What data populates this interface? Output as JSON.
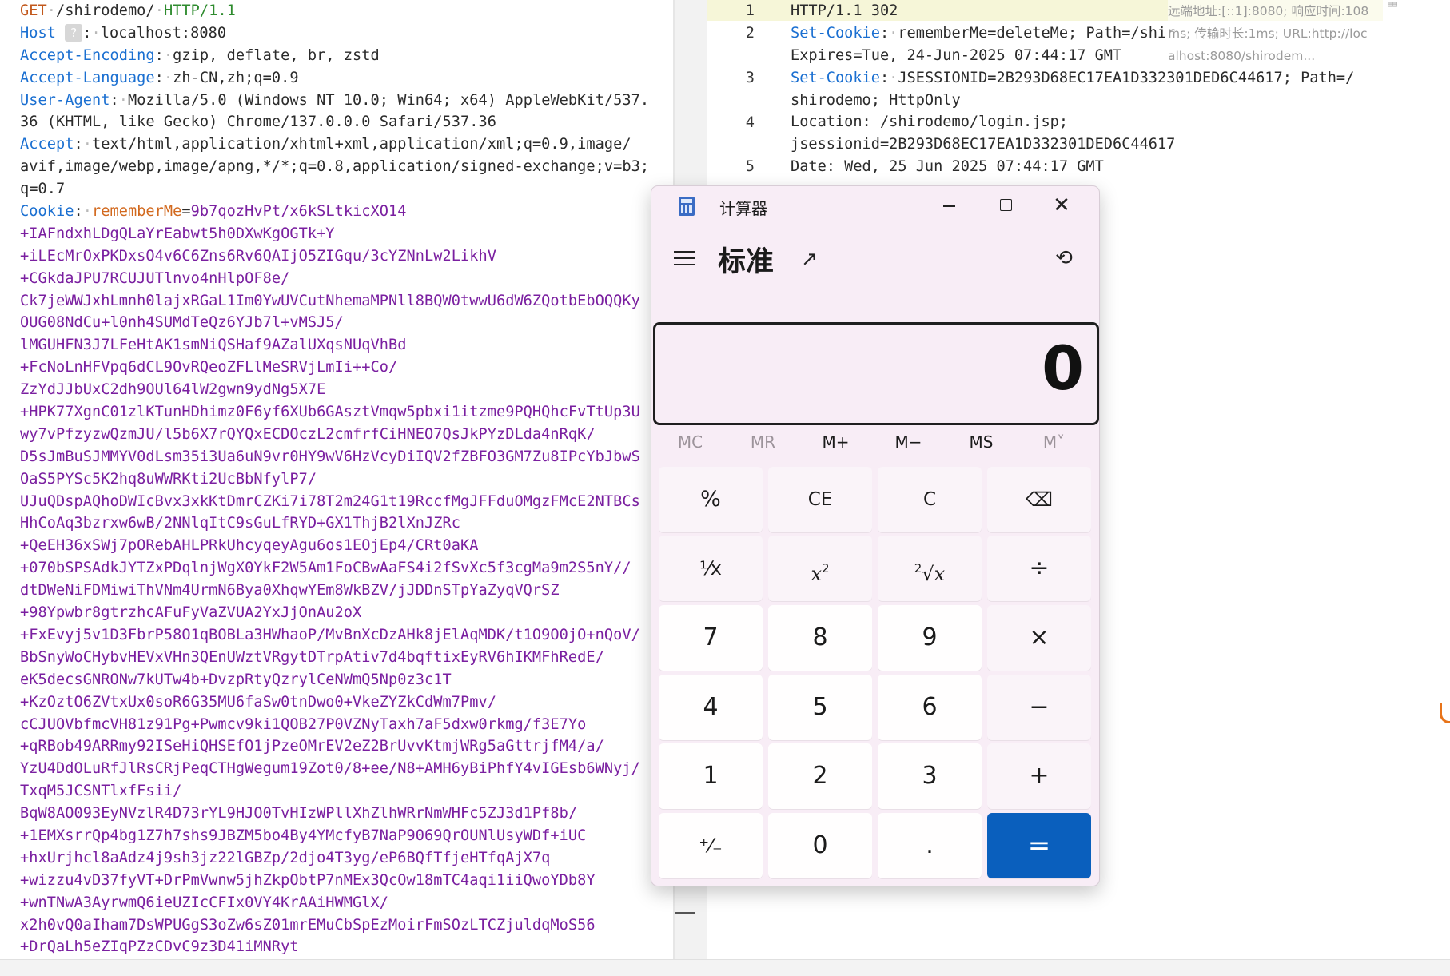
{
  "request": {
    "line1": {
      "method": "GET",
      "path": "/shirodemo/",
      "protocol": "HTTP/1.1"
    },
    "host": {
      "name": "Host",
      "hint": "?",
      "value": "localhost:8080"
    },
    "accept_encoding": {
      "name": "Accept-Encoding",
      "value": "gzip, deflate, br, zstd"
    },
    "accept_language": {
      "name": "Accept-Language",
      "value": "zh-CN,zh;q=0.9"
    },
    "user_agent": {
      "name": "User-Agent",
      "value_1": "Mozilla/5.0 (Windows NT 10.0; Win64; x64) AppleWebKit/537.",
      "value_2": "36 (KHTML, like Gecko) Chrome/137.0.0.0 Safari/537.36"
    },
    "accept": {
      "name": "Accept",
      "value_1": "text/html,application/xhtml+xml,application/xml;q=0.9,image/",
      "value_2": "avif,image/webp,image/apng,*/*;q=0.8,application/signed-exchange;v=b3;",
      "value_3": "q=0.7"
    },
    "cookie": {
      "name": "Cookie",
      "key": "rememberMe",
      "first": "9b7qozHvPt/x6kSLtkicXO14",
      "lines": [
        "+IAFndxhLDgQLaYrEabwt5h0DXwKgOGTk+Y",
        "+iLEcMrOxPKDxsO4v6C6Zns6Rv6QAIjO5ZIGqu/3cYZNnLw2LikhV",
        "+CGkdaJPU7RCUJUTlnvo4nHlpOF8e/",
        "Ck7jeWWJxhLmnh0lajxRGaL1Im0YwUVCutNhemaMPNll8BQW0twwU6dW6ZQotbEbOQQKy",
        "OUG08NdCu+l0nh4SUMdTeQz6YJb7l+vMSJ5/",
        "lMGUHFN3J7LFeHtAK1smNiQSHaf9AZalUXqsNUqVhBd",
        "+FcNoLnHFVpq6dCL9OvRQeoZFLlMeSRVjLmIi++Co/",
        "ZzYdJJbUxC2dh9OUl64lW2gwn9ydNg5X7E",
        "+HPK77XgnC01zlKTunHDhimz0F6yf6XUb6GAsztVmqw5pbxi1itzme9PQHQhcFvTtUp3U",
        "wy7vPfzyzwQzmJU/l5b6X7rQYQxECDOczL2cmfrfCiHNEO7QsJkPYzDLda4nRqK/",
        "D5sJmBuSJMMYV0dLsm35i3Ua6uN9vr0HY9wV6HzVcyDiIQV2fZBFO3GM7Zu8IPcYbJbwS",
        "OaS5PYSc5K2hq8uWWRKti2UcBbNfylP7/",
        "UJuQDspAQhoDWIcBvx3xkKtDmrCZKi7i78T2m24G1t19RccfMgJFFduOMgzFMcE2NTBCs",
        "HhCoAq3bzrxw6wB/2NNlqItC9sGuLfRYD+GX1ThjB2lXnJZRc",
        "+QeEH36xSWj7pORebAHLPRkUhcyqeyAgu6os1EOjEp4/CRt0aKA",
        "+070bSPSAdkJYTZxPDqlnjWgX0YkF2W5Am1FoCBwAaFS4i2fSvXc5f3cgMa9m2S5nY//",
        "dtDWeNiFDMiwiThVNm4UrmN6Bya0XhqwYEm8WkBZV/jJDDnSTpYaZyqVQrSZ",
        "+98Ypwbr8gtrzhcAFuFyVaZVUA2YxJjOnAu2oX",
        "+FxEvyj5v1D3FbrP58O1qBOBLa3HWhaoP/MvBnXcDzAHk8jElAqMDK/t1O9O0jO+nQoV/",
        "BbSnyWoCHybvHEVxVHn3QEnUWztVRgytDTrpAtiv7d4bqftixEyRV6hIKMFhRedE/",
        "eK5decsGNRONw7kUTw4b+DvzpRtyQzrylCeNWmQ5Np0z3c1T",
        "+KzOztO6ZVtxUx0soR6G35MU6faSw0tnDwo0+VkeZYZkCdWm7Pmv/",
        "cCJUOVbfmcVH81z91Pg+Pwmcv9ki1QOB27P0VZNyTaxh7aF5dxw0rkmg/f3E7Yo",
        "+qRBob49ARRmy92ISeHiQHSEfO1jPzeOMrEV2eZ2BrUvvKtmjWRg5aGttrjfM4/a/",
        "YzU4DdOLuRfJlRsCRjPeqCTHgWegum19Zot0/8+ee/N8+AMH6yBiPhfY4vIGEsb6WNyj/",
        "TxqM5JCSNTlxfFsii/",
        "BqW8AO093EyNVzlR4D73rYL9HJO0TvHIzWPllXhZlhWRrNmWHFc5ZJ3d1Pf8b/",
        "+1EMXsrrQp4bg1Z7h7shs9JBZM5bo4By4YMcfyB7NaP9069QrOUNlUsyWDf+iUC",
        "+hxUrjhcl8aAdz4j9sh3jz22lGBZp/2djo4T3yg/eP6BQfTfjeHTfqAjX7q",
        "+wizzu4vD37fyVT+DrPmVwnw5jhZkpObtP7nMEx3QcOw18mTC4aqi1iiQwoYDb8Y",
        "+wnTNwA3AyrwmQ6ieUZIcCFIx0VY4KrAAiHWMGlX/",
        "x2h0vQ0aIham7DsWPUGgS3oZw6sZ01mrEMuCbSpEzMoirFmSOzLTCZjuldqMoS56",
        "+DrQaLh5eZIqPZzCDvC9z3D41iMNRyt"
      ]
    }
  },
  "response": {
    "line_numbers": [
      "1",
      "2",
      "3",
      "4",
      "5"
    ],
    "status": "HTTP/1.1 302",
    "set_cookie_1": {
      "name": "Set-Cookie",
      "value_1": "rememberMe=deleteMe; Path=/shir",
      "value_2": "Expires=Tue, 24-Jun-2025 07:44:17 GMT"
    },
    "set_cookie_2": {
      "name": "Set-Cookie",
      "value_1": "JSESSIONID=2B293D68EC17EA1D332301DED6C44617; Path=/",
      "value_2": "shirodemo; HttpOnly"
    },
    "location": {
      "value_1": "Location: /shirodemo/login.jsp;",
      "value_2": "jsessionid=2B293D68EC17EA1D332301DED6C44617"
    },
    "date": "Date: Wed, 25 Jun 2025 07:44:17 GMT"
  },
  "tooltip": {
    "line1": "远端地址:[::1]:8080; 响应时间:108",
    "line2": "ms; 传输时长:1ms; URL:http://loc",
    "line3": "alhost:8080/shirodem..."
  },
  "calculator": {
    "window_title": "计算器",
    "mode": "标准",
    "display": "0",
    "memory": [
      "MC",
      "MR",
      "M+",
      "M−",
      "MS",
      "M˅"
    ],
    "keys": {
      "percent": "%",
      "ce": "CE",
      "c": "C",
      "backspace": "⌫",
      "reciprocal": "⅟x",
      "square_base": "x",
      "square_exp": "2",
      "sqrt_index": "2",
      "sqrt_sign": "√",
      "sqrt_base": "x",
      "divide": "÷",
      "n7": "7",
      "n8": "8",
      "n9": "9",
      "multiply": "×",
      "n4": "4",
      "n5": "5",
      "n6": "6",
      "minus": "−",
      "n1": "1",
      "n2": "2",
      "n3": "3",
      "plus": "+",
      "negate": "⁺⁄₋",
      "n0": "0",
      "decimal": ".",
      "equals": "="
    },
    "icons": {
      "app": "calculator-icon",
      "menu": "hamburger-icon",
      "keep_on_top": "keep-on-top-icon",
      "history": "history-icon",
      "close": "✕",
      "history_glyph": "⟲",
      "keep_glyph": "↗"
    },
    "accent_color": "#0a5fbd"
  }
}
